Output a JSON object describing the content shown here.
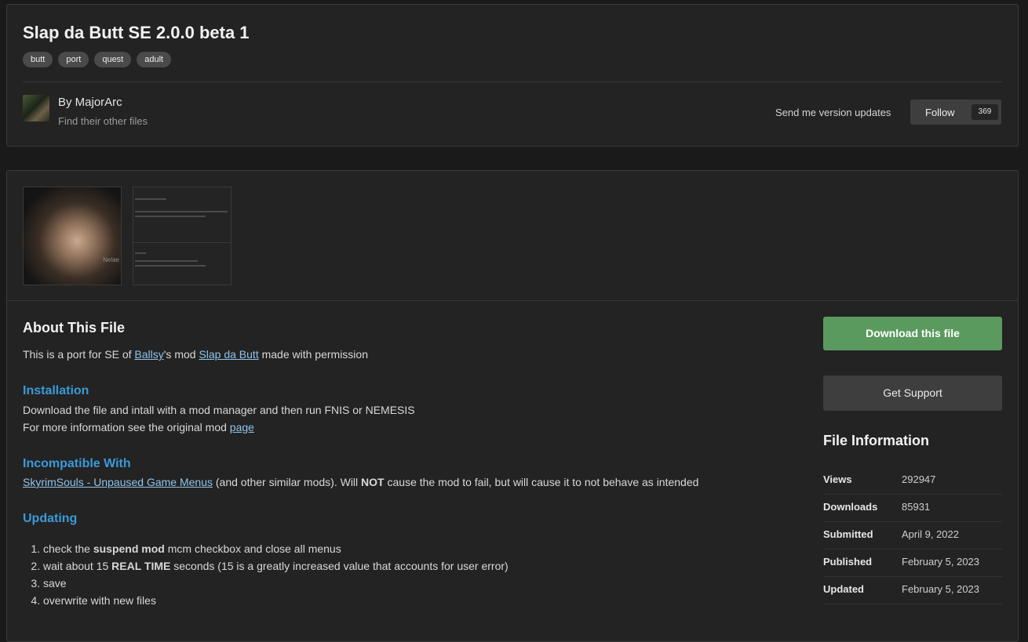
{
  "header": {
    "title": "Slap da Butt SE 2.0.0 beta 1",
    "tags": [
      "butt",
      "port",
      "quest",
      "adult"
    ],
    "author_by": "By MajorArc",
    "author_link": "Find their other files",
    "send_updates": "Send me version updates",
    "follow_label": "Follow",
    "follow_count": "369"
  },
  "gallery": {
    "thumb1_watermark": "Nelae"
  },
  "about": {
    "title": "About This File",
    "intro_prefix": "This is a port for SE of ",
    "intro_link1": "Ballsy",
    "intro_mid": "'s mod ",
    "intro_link2": "Slap da Butt",
    "intro_suffix": " made with permission",
    "installation_title": "Installation",
    "installation_line1": "Download the file and intall with a mod manager and then run FNIS or NEMESIS",
    "installation_line2_prefix": "For more information see the original mod ",
    "installation_line2_link": "page",
    "incompatible_title": "Incompatible With",
    "incompatible_link": "SkyrimSouls - Unpaused Game Menus",
    "incompatible_text1": " (and other similar mods). Will ",
    "incompatible_bold": "NOT",
    "incompatible_text2": " cause the mod to fail, but will cause it to not behave as intended",
    "updating_title": "Updating",
    "step1_a": "check the ",
    "step1_b": "suspend mod",
    "step1_c": " mcm checkbox and close all menus",
    "step2_a": "wait about 15 ",
    "step2_b": "REAL TIME",
    "step2_c": " seconds (15 is a greatly increased value that accounts for user error)",
    "step3": "save",
    "step4": "overwrite with new files"
  },
  "sidebar": {
    "download_label": "Download this file",
    "support_label": "Get Support",
    "file_info_title": "File Information",
    "rows": [
      {
        "key": "Views",
        "value": "292947"
      },
      {
        "key": "Downloads",
        "value": "85931"
      },
      {
        "key": "Submitted",
        "value": "April 9, 2022"
      },
      {
        "key": "Published",
        "value": "February 5, 2023"
      },
      {
        "key": "Updated",
        "value": "February 5, 2023"
      }
    ]
  },
  "colors": {
    "accent_heading": "#3a9ad9",
    "download_green": "#5b9a5f",
    "link": "#8fc3ea"
  }
}
